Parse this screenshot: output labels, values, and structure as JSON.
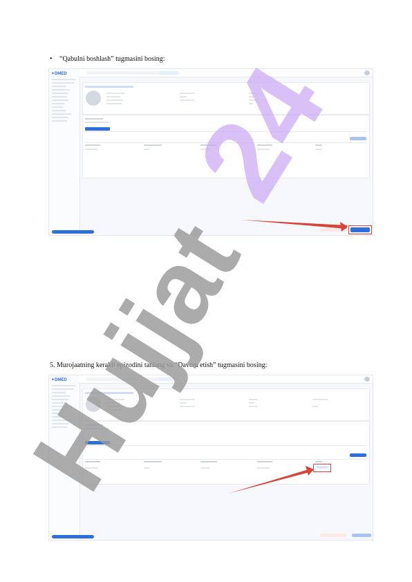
{
  "instructions": {
    "first": {
      "bullet": "•",
      "text": "“Qabulni boshlash” tugmasini bosing:"
    },
    "second": {
      "text": "5.  Murojaatning kerakli epizodini tanlang va “Davom etish” tugmasini bosing:"
    }
  },
  "screenshots": [
    {
      "logo": "✦DMED",
      "highlight": "start-button"
    },
    {
      "logo": "✦DMED",
      "highlight": "continue-button"
    }
  ],
  "watermark": {
    "text": "Hujjat 24"
  },
  "colors": {
    "accent": "#2f6fdc",
    "arrow": "#d9443a",
    "watermark_purple": "#c9a6f5",
    "watermark_gray": "#9c9c9c"
  }
}
